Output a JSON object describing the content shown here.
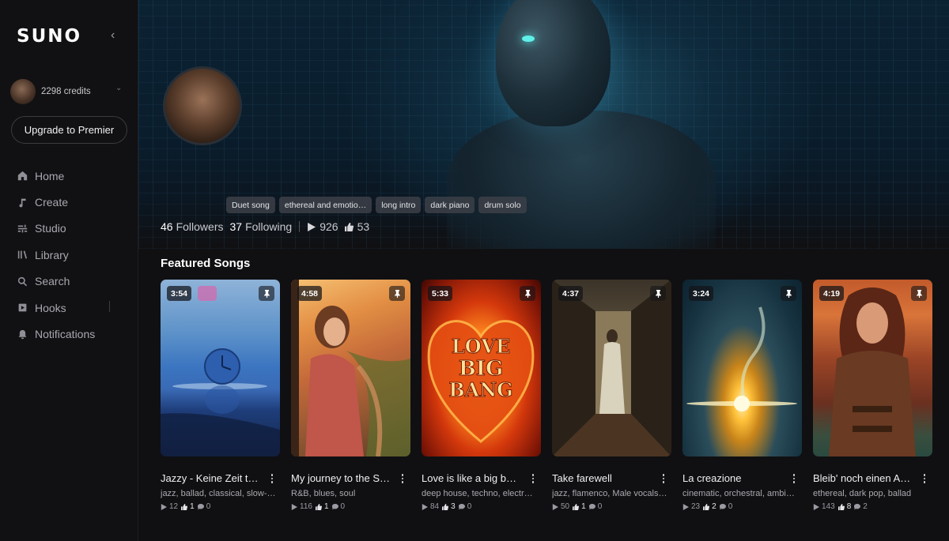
{
  "app": {
    "logo": "SUNO"
  },
  "sidebar": {
    "credits": "2298 credits",
    "upgrade_label": "Upgrade to Premier",
    "items": [
      {
        "label": "Home",
        "icon": "home-icon"
      },
      {
        "label": "Create",
        "icon": "music-note-icon"
      },
      {
        "label": "Studio",
        "icon": "studio-icon"
      },
      {
        "label": "Library",
        "icon": "library-icon"
      },
      {
        "label": "Search",
        "icon": "search-icon"
      },
      {
        "label": "Hooks",
        "icon": "hooks-icon"
      },
      {
        "label": "Notifications",
        "icon": "bell-icon"
      }
    ]
  },
  "profile": {
    "tags": [
      "Duet song",
      "ethereal and emotio…",
      "long intro",
      "dark piano",
      "drum solo"
    ],
    "followers_count": "46",
    "followers_label": "Followers",
    "following_count": "37",
    "following_label": "Following",
    "plays": "926",
    "likes": "53"
  },
  "featured": {
    "title": "Featured Songs",
    "songs": [
      {
        "duration": "3:54",
        "title": "Jazzy - Keine Zeit t…",
        "genre": "jazz, ballad, classical, slow-…",
        "plays": "12",
        "likes": "1",
        "comments": "0"
      },
      {
        "duration": "4:58",
        "title": "My journey to the S…",
        "genre": "R&B, blues, soul",
        "plays": "116",
        "likes": "1",
        "comments": "0"
      },
      {
        "duration": "5:33",
        "title": "Love is like a big ba…",
        "genre": "deep house, techno, electr…",
        "plays": "84",
        "likes": "3",
        "comments": "0"
      },
      {
        "duration": "4:37",
        "title": "Take farewell",
        "genre": "jazz, flamenco, Male vocals,…",
        "plays": "50",
        "likes": "1",
        "comments": "0"
      },
      {
        "duration": "3:24",
        "title": "La creazione",
        "genre": "cinematic, orchestral, ambi…",
        "plays": "23",
        "likes": "2",
        "comments": "0"
      },
      {
        "duration": "4:19",
        "title": "Bleib' noch einen A…",
        "genre": "ethereal, dark pop, ballad",
        "plays": "143",
        "likes": "8",
        "comments": "2"
      }
    ]
  },
  "artwork": {
    "love_line1": "LOVE",
    "love_line2": "BIG",
    "love_line3": "BANG"
  }
}
